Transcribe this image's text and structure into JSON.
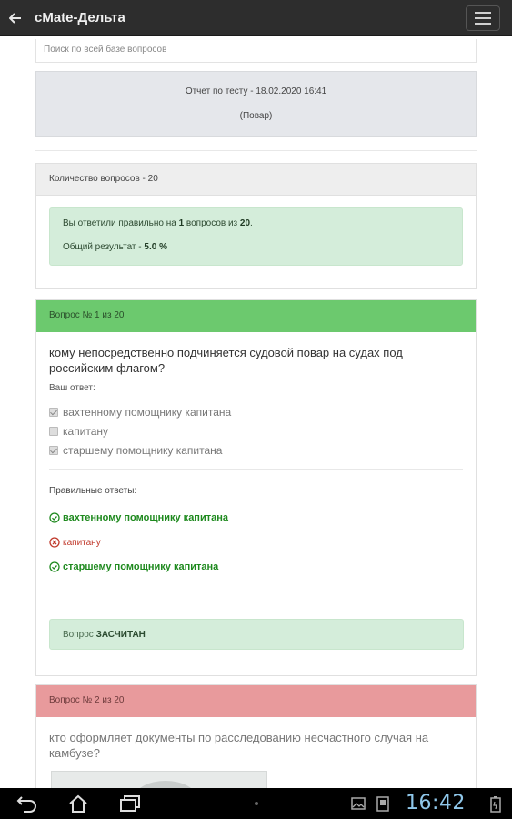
{
  "appbar": {
    "title": "cMate-Дельта"
  },
  "search": {
    "placeholder": "Поиск по всей базе вопросов"
  },
  "report": {
    "title": "Отчет по тесту - 18.02.2020 16:41",
    "subtitle": "(Повар)"
  },
  "summary": {
    "header": "Количество вопросов - 20",
    "line1_prefix": "Вы ответили правильно на ",
    "correct_count": "1",
    "line1_mid": " вопросов из ",
    "total_count": "20",
    "line1_suffix": ".",
    "line2_prefix": "Общий результат - ",
    "score": "5.0 %"
  },
  "question1": {
    "header": "Вопрос № 1 из 20",
    "text": "кому непосредственно подчиняется судовой повар на судах под российским флагом?",
    "your_answer_label": "Ваш ответ:",
    "options": [
      {
        "label": "вахтенному помощнику капитана",
        "checked": true
      },
      {
        "label": "капитану",
        "checked": false
      },
      {
        "label": "старшему помощнику капитана",
        "checked": true
      }
    ],
    "correct_label": "Правильные ответы:",
    "results": [
      {
        "label": "вахтенному помощнику капитана",
        "status": "correct"
      },
      {
        "label": "капитану",
        "status": "wrong"
      },
      {
        "label": "старшему помощнику капитана",
        "status": "correct"
      }
    ],
    "verdict_prefix": "Вопрос ",
    "verdict": "ЗАСЧИТАН"
  },
  "question2": {
    "header": "Вопрос № 2 из 20",
    "text": "кто оформляет документы по расследованию несчастного случая на камбузе?"
  },
  "statusbar": {
    "time": "16:42"
  },
  "colors": {
    "appbar": "#2d2d2d",
    "success_header": "#6cc96e",
    "fail_header": "#e89a9c",
    "alert_success": "#d4edda",
    "correct_text": "#1f8a1f",
    "wrong_text": "#c0392b",
    "clock": "#8fc7ea"
  },
  "icons": {
    "back": "arrow-left-icon",
    "menu": "hamburger-menu-icon",
    "correct": "check-circle-icon",
    "wrong": "x-circle-icon",
    "nav_back": "nav-back-icon",
    "nav_home": "nav-home-icon",
    "nav_recent": "nav-recent-apps-icon"
  }
}
